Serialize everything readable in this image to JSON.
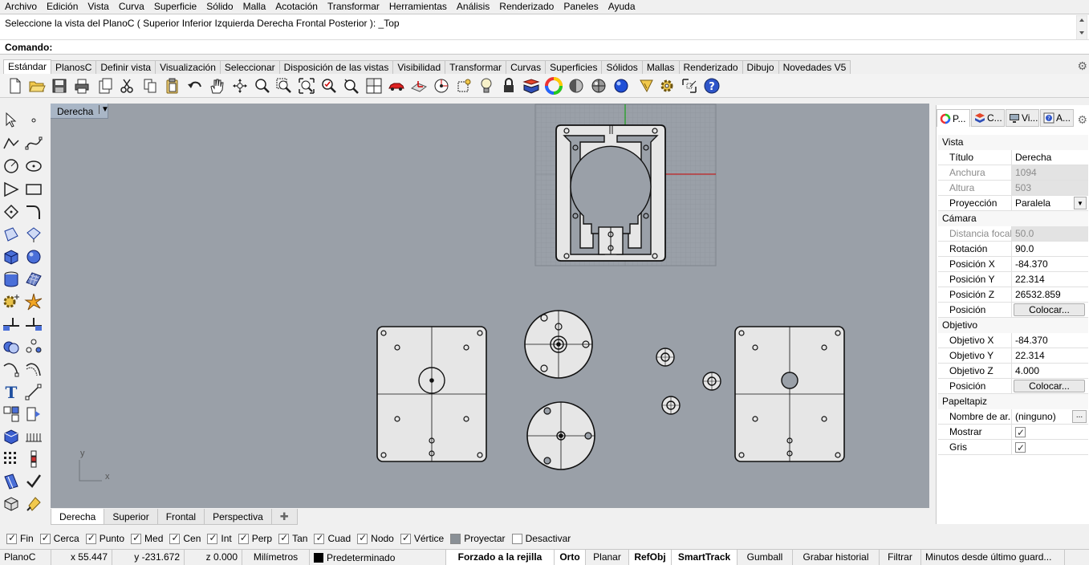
{
  "menu": [
    "Archivo",
    "Edición",
    "Vista",
    "Curva",
    "Superficie",
    "Sólido",
    "Malla",
    "Acotación",
    "Transformar",
    "Herramientas",
    "Análisis",
    "Renderizado",
    "Paneles",
    "Ayuda"
  ],
  "command": {
    "history": "Seleccione la vista del PlanoC ( Superior  Inferior  Izquierda  Derecha  Frontal  Posterior ): _Top",
    "prompt": "Comando:"
  },
  "toolbar_tabs": [
    "Estándar",
    "PlanosC",
    "Definir vista",
    "Visualización",
    "Seleccionar",
    "Disposición de las vistas",
    "Visibilidad",
    "Transformar",
    "Curvas",
    "Superficies",
    "Sólidos",
    "Mallas",
    "Renderizado",
    "Dibujo",
    "Novedades V5"
  ],
  "toolbar_icons": [
    "new-file-icon",
    "open-folder-icon",
    "save-icon",
    "print-icon",
    "import-icon",
    "cut-icon",
    "copy-icon",
    "paste-icon",
    "undo-icon",
    "pan-hand-icon",
    "rotate-view-icon",
    "zoom-icon",
    "zoom-window-icon",
    "zoom-extents-icon",
    "zoom-selected-icon",
    "four-views-icon",
    "car-icon",
    "cplane-icon",
    "cplane-origin-icon",
    "snap-icon",
    "light-bulb-icon",
    "lock-icon",
    "layer-icon",
    "color-wheel-icon",
    "shade-icon",
    "render-sphere-icon",
    "render-blue-sphere-icon",
    "grasshopper-icon",
    "gear-options-icon",
    "box-edit-icon",
    "help-icon"
  ],
  "viewport": {
    "title": "Derecha",
    "axis_x": "x",
    "axis_y": "y"
  },
  "view_tabs": [
    "Derecha",
    "Superior",
    "Frontal",
    "Perspectiva"
  ],
  "osnaps": [
    {
      "label": "Fin",
      "on": true
    },
    {
      "label": "Cerca",
      "on": true
    },
    {
      "label": "Punto",
      "on": true
    },
    {
      "label": "Med",
      "on": true
    },
    {
      "label": "Cen",
      "on": true
    },
    {
      "label": "Int",
      "on": true
    },
    {
      "label": "Perp",
      "on": true
    },
    {
      "label": "Tan",
      "on": true
    },
    {
      "label": "Cuad",
      "on": true
    },
    {
      "label": "Nodo",
      "on": true
    },
    {
      "label": "Vértice",
      "on": true
    },
    {
      "label": "Proyectar",
      "on": false
    },
    {
      "label": "Desactivar",
      "on": false
    }
  ],
  "status": {
    "cplane": "PlanoC",
    "x": "x 55.447",
    "y": "y -231.672",
    "z": "z 0.000",
    "units": "Milímetros",
    "layer": "Predeterminado",
    "grid_snap": "Forzado a la rejilla",
    "ortho": "Orto",
    "planar": "Planar",
    "osnap": "RefObj",
    "smarttrack": "SmartTrack",
    "gumball": "Gumball",
    "history": "Grabar historial",
    "filter": "Filtrar",
    "minutes": "Minutos desde último guard..."
  },
  "panel": {
    "tabs": [
      {
        "label": "P...",
        "icon": "properties-icon"
      },
      {
        "label": "C...",
        "icon": "layers-icon"
      },
      {
        "label": "Vi...",
        "icon": "display-icon"
      },
      {
        "label": "A...",
        "icon": "help-panel-icon"
      }
    ],
    "vista": {
      "section": "Vista",
      "titulo_k": "Título",
      "titulo_v": "Derecha",
      "anchura_k": "Anchura",
      "anchura_v": "1094",
      "altura_k": "Altura",
      "altura_v": "503",
      "proyeccion_k": "Proyección",
      "proyeccion_v": "Paralela"
    },
    "camara": {
      "section": "Cámara",
      "focal_k": "Distancia focal",
      "focal_v": "50.0",
      "rot_k": "Rotación",
      "rot_v": "90.0",
      "px_k": "Posición X",
      "px_v": "-84.370",
      "py_k": "Posición Y",
      "py_v": "22.314",
      "pz_k": "Posición Z",
      "pz_v": "26532.859",
      "pos_k": "Posición",
      "pos_btn": "Colocar..."
    },
    "objetivo": {
      "section": "Objetivo",
      "ox_k": "Objetivo X",
      "ox_v": "-84.370",
      "oy_k": "Objetivo Y",
      "oy_v": "22.314",
      "oz_k": "Objetivo Z",
      "oz_v": "4.000",
      "pos_k": "Posición",
      "pos_btn": "Colocar..."
    },
    "papel": {
      "section": "Papeltapiz",
      "nombre_k": "Nombre de ar...",
      "nombre_v": "(ninguno)",
      "mostrar_k": "Mostrar",
      "gris_k": "Gris"
    }
  }
}
